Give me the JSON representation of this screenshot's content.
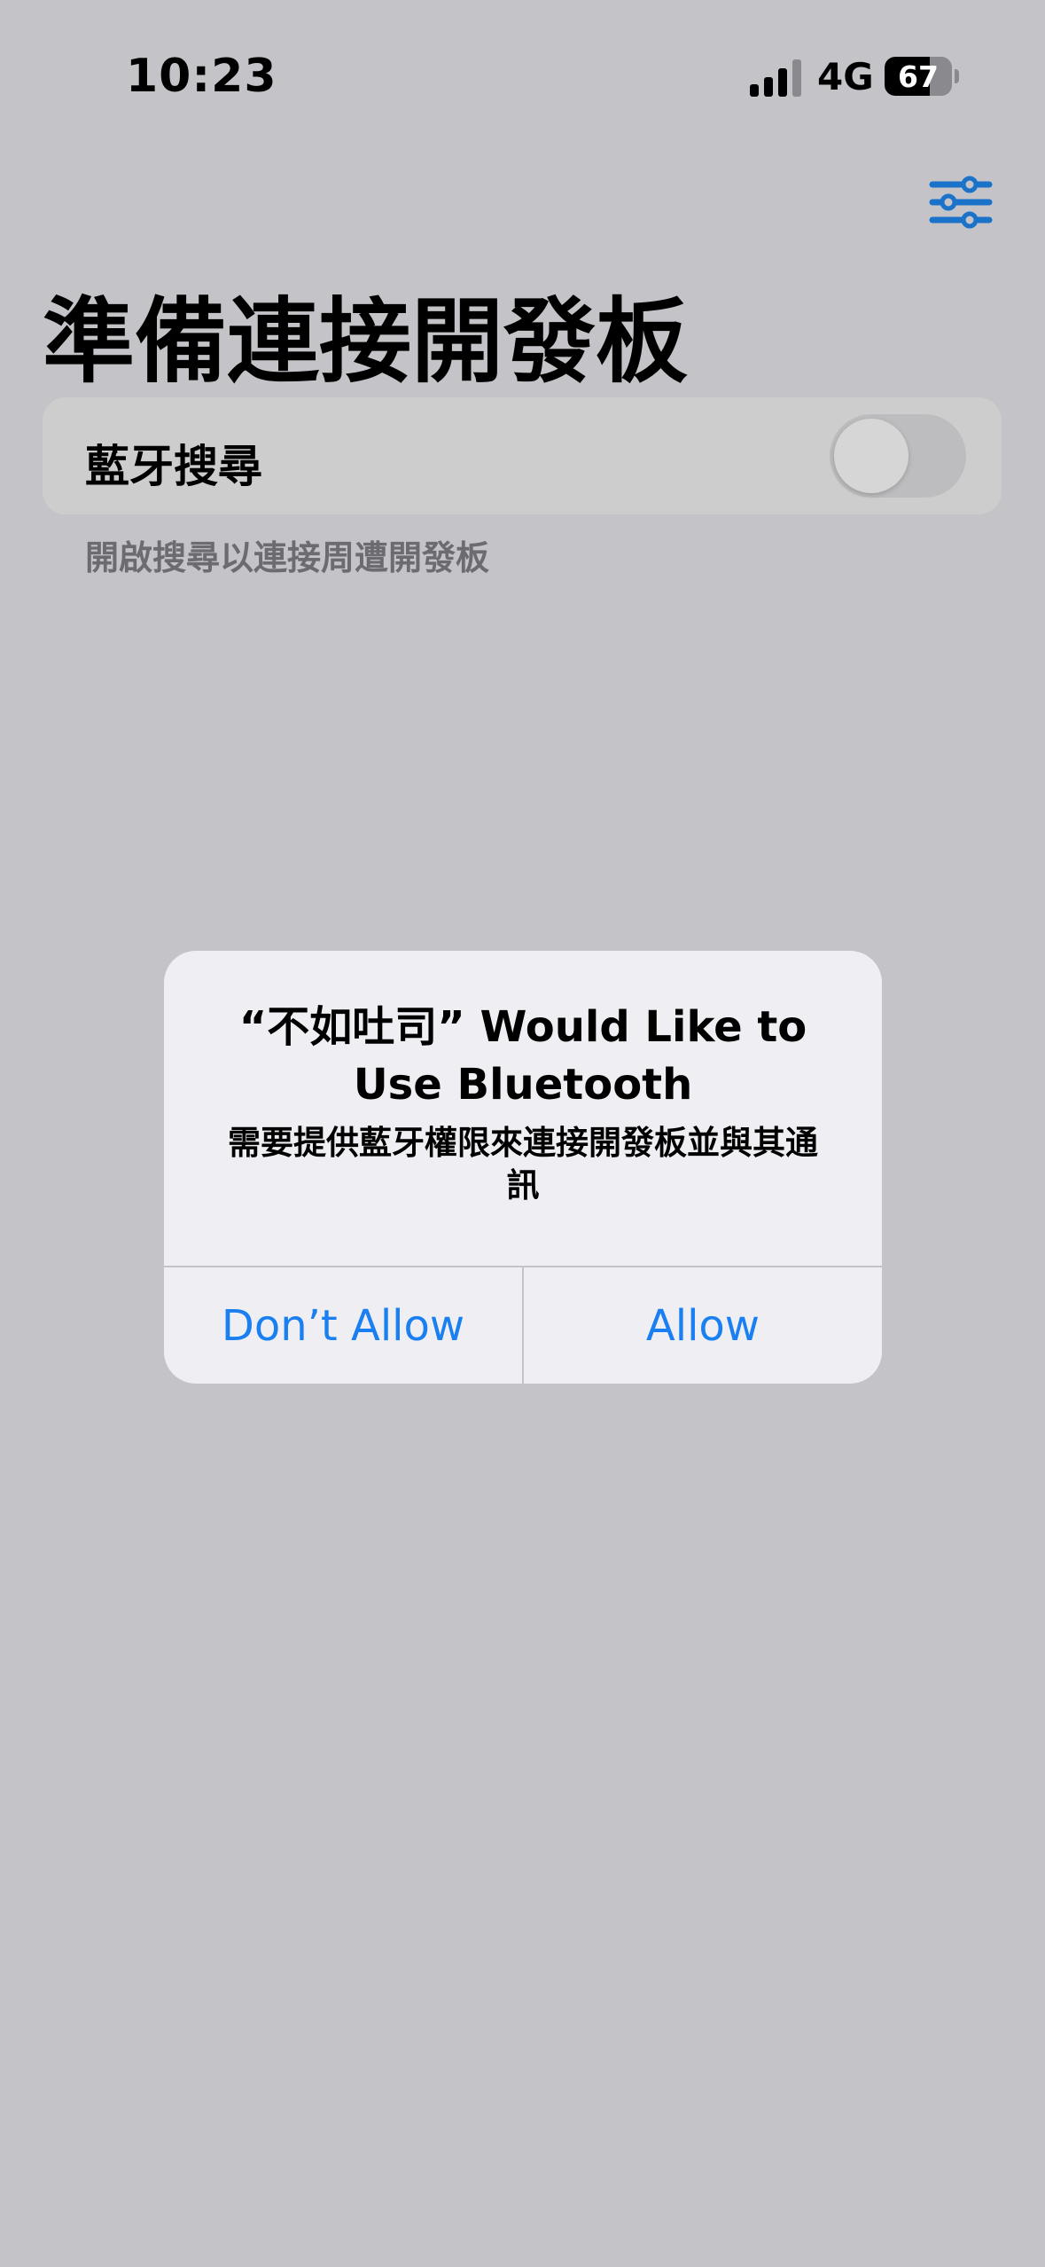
{
  "status_bar": {
    "time": "10:23",
    "network": "4G",
    "battery_level": "67",
    "battery_fraction": 0.67,
    "signal_bars_active": 3,
    "signal_bars_total": 4
  },
  "header": {
    "settings_icon": "sliders-icon",
    "title": "準備連接開發板"
  },
  "bluetooth_section": {
    "label": "藍牙搜尋",
    "toggle_on": false,
    "footer": "開啟搜尋以連接周遭開發板"
  },
  "alert": {
    "title": "“不如吐司” Would Like to Use Bluetooth",
    "message": "需要提供藍牙權限來連接開發板並與其通訊",
    "deny_label": "Don’t Allow",
    "allow_label": "Allow"
  },
  "colors": {
    "accent": "#1a7ff0",
    "icon_blue": "#1b72c9",
    "background": "#c4c3c8",
    "alert_background": "#efeff3"
  }
}
